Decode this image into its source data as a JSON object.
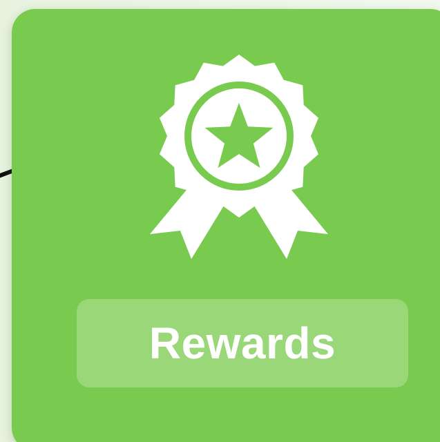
{
  "tile": {
    "label": "Rewards",
    "icon": "award-ribbon-icon",
    "background_color": "#79cb50",
    "icon_color": "#ffffff"
  },
  "connector": {
    "color": "#111111"
  }
}
